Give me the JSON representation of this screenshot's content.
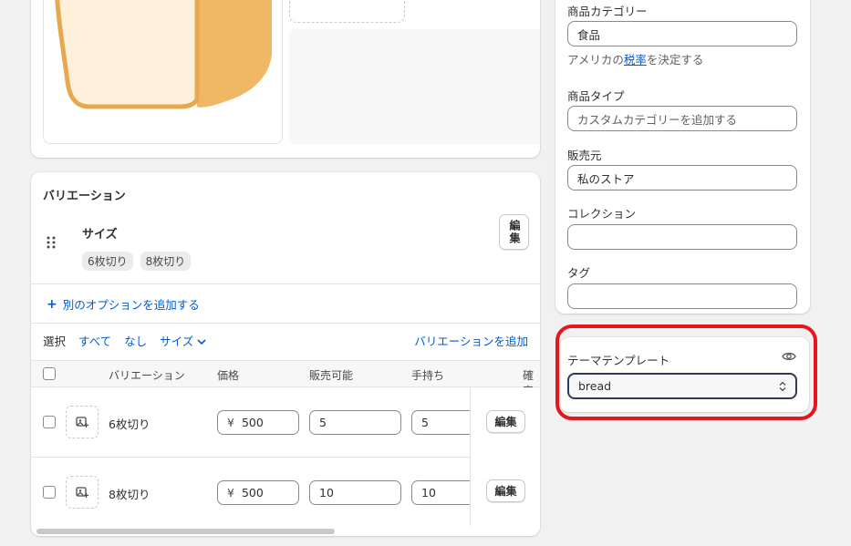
{
  "variations": {
    "title": "バリエーション",
    "option": {
      "name": "サイズ",
      "values": [
        "6枚切り",
        "8枚切り"
      ],
      "edit_label": "編集"
    },
    "add_option_label": "別のオプションを追加する",
    "filter": {
      "select_label": "選択",
      "all": "すべて",
      "none": "なし",
      "size": "サイズ",
      "add_variation": "バリエーションを追加"
    },
    "columns": [
      "バリエーション",
      "価格",
      "販売可能",
      "手持ち",
      "確定"
    ],
    "rows": [
      {
        "name": "6枚切り",
        "currency": "¥",
        "price": "500",
        "available": "5",
        "on_hand": "5",
        "edit_label": "編集"
      },
      {
        "name": "8枚切り",
        "currency": "¥",
        "price": "500",
        "available": "10",
        "on_hand": "10",
        "edit_label": "編集"
      }
    ]
  },
  "organization": {
    "category_label": "商品カテゴリー",
    "category_value": "食品",
    "help_prefix": "アメリカの",
    "help_link": "税率",
    "help_suffix": "を決定する",
    "type_label": "商品タイプ",
    "type_placeholder": "カスタムカテゴリーを追加する",
    "vendor_label": "販売元",
    "vendor_value": "私のストア",
    "collection_label": "コレクション",
    "collection_value": "",
    "tag_label": "タグ",
    "tag_value": ""
  },
  "theme": {
    "label": "テーマテンプレート",
    "selected": "bread"
  },
  "colors": {
    "link": "#005bd3",
    "highlight": "#e5161e",
    "bread_crust": "#f0b765",
    "bread_crumb": "#fff0dc"
  },
  "icons": {
    "drag": "drag-handle-icon",
    "plus": "plus-icon",
    "chevron": "chevron-down-icon",
    "image_add": "image-add-icon",
    "eye": "eye-icon",
    "select_caret": "select-caret-icon"
  }
}
